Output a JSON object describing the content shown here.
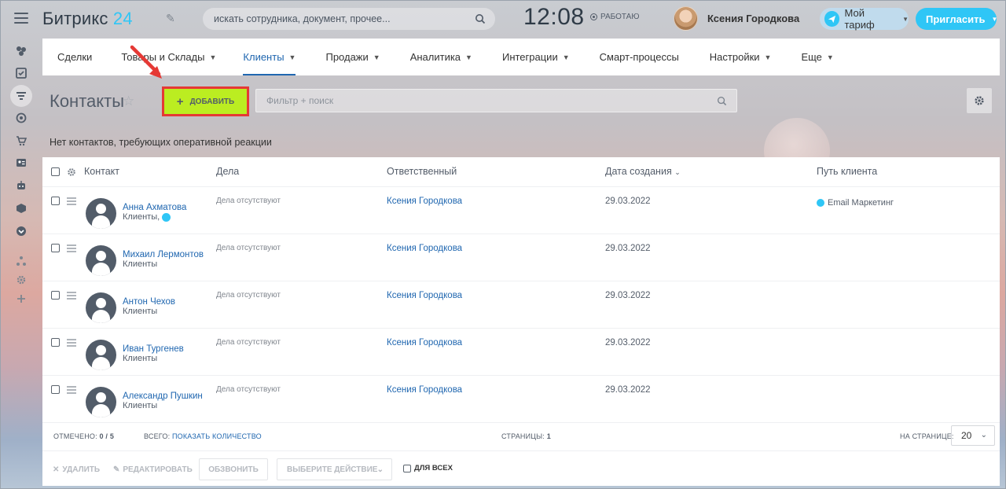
{
  "header": {
    "logo_text": "Битрикс",
    "logo_num": "24",
    "search_placeholder": "искать сотрудника, документ, прочее...",
    "clock": "12:08",
    "work_status": "РАБОТАЮ",
    "user_name": "Ксения Городкова",
    "tariff_label": "Мой тариф",
    "invite_label": "Пригласить"
  },
  "nav": {
    "items": [
      {
        "label": "Сделки"
      },
      {
        "label": "Товары и Склады"
      },
      {
        "label": "Клиенты"
      },
      {
        "label": "Продажи"
      },
      {
        "label": "Аналитика"
      },
      {
        "label": "Интеграции"
      },
      {
        "label": "Смарт-процессы"
      },
      {
        "label": "Настройки"
      },
      {
        "label": "Еще"
      }
    ]
  },
  "toolbar": {
    "title": "Контакты",
    "add_label": "ДОБАВИТЬ",
    "filter_placeholder": "Фильтр + поиск"
  },
  "notice": "Нет контактов, требующих оперативной реакции",
  "grid": {
    "columns": {
      "contact": "Контакт",
      "deals": "Дела",
      "responsible": "Ответственный",
      "created": "Дата создания",
      "path": "Путь клиента"
    },
    "rows": [
      {
        "name": "Анна Ахматова",
        "type": "Клиенты,",
        "deals": "Дела отсутствуют",
        "responsible": "Ксения Городкова",
        "date": "29.03.2022",
        "path": "Email Маркетинг"
      },
      {
        "name": "Михаил Лермонтов",
        "type": "Клиенты",
        "deals": "Дела отсутствуют",
        "responsible": "Ксения Городкова",
        "date": "29.03.2022",
        "path": ""
      },
      {
        "name": "Антон Чехов",
        "type": "Клиенты",
        "deals": "Дела отсутствуют",
        "responsible": "Ксения Городкова",
        "date": "29.03.2022",
        "path": ""
      },
      {
        "name": "Иван Тургенев",
        "type": "Клиенты",
        "deals": "Дела отсутствуют",
        "responsible": "Ксения Городкова",
        "date": "29.03.2022",
        "path": ""
      },
      {
        "name": "Александр Пушкин",
        "type": "Клиенты",
        "deals": "Дела отсутствуют",
        "responsible": "Ксения Городкова",
        "date": "29.03.2022",
        "path": ""
      }
    ],
    "footer": {
      "marked_label": "ОТМЕЧЕНО:",
      "marked_value": "0 / 5",
      "total_label": "ВСЕГО:",
      "total_link": "ПОКАЗАТЬ КОЛИЧЕСТВО",
      "pages_label": "СТРАНИЦЫ:",
      "pages_value": "1",
      "per_page_label": "НА СТРАНИЦЕ:",
      "per_page_value": "20"
    }
  },
  "actions": {
    "delete": "УДАЛИТЬ",
    "edit": "РЕДАКТИРОВАТЬ",
    "call": "ОБЗВОНИТЬ",
    "choose": "ВЫБЕРИТЕ ДЕЙСТВИЕ",
    "for_all": "ДЛЯ ВСЕХ"
  },
  "colors": {
    "accent": "#2fc6f6",
    "link": "#2067b0",
    "add_button": "#bbed21",
    "highlight": "#e53935"
  }
}
